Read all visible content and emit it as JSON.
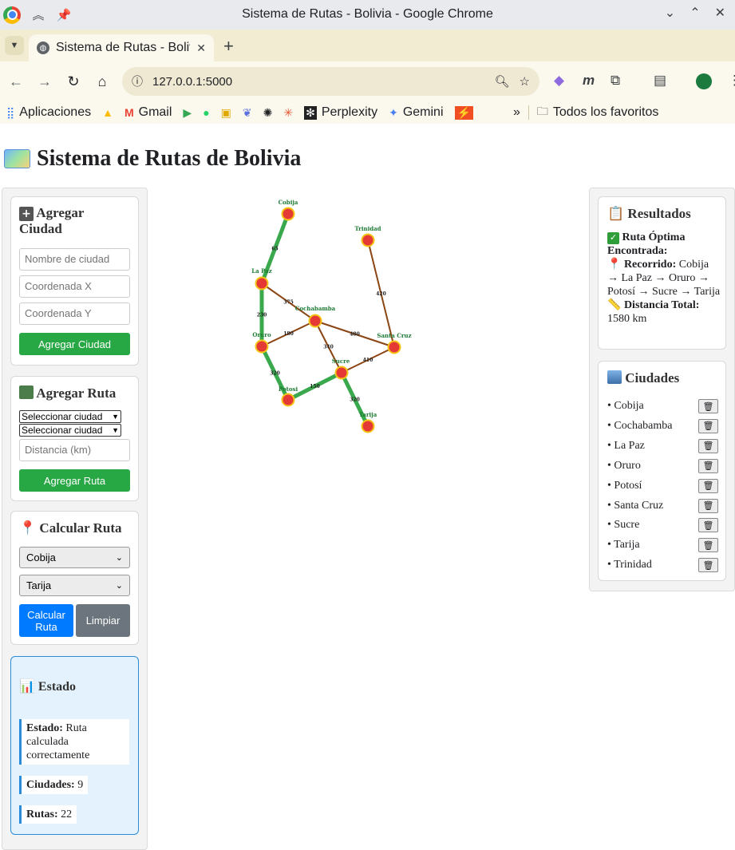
{
  "browser": {
    "window_title": "Sistema de Rutas - Bolivia - Google Chrome",
    "tab_title": "Sistema de Rutas - Bolivia",
    "url": "127.0.0.1:5000",
    "bookmarks": [
      "Aplicaciones",
      "Gmail",
      "Perplexity",
      "Gemini"
    ],
    "all_bookmarks": "Todos los favoritos"
  },
  "page": {
    "title": "Sistema de Rutas de Bolivia"
  },
  "add_city": {
    "title": "Agregar Ciudad",
    "name_placeholder": "Nombre de ciudad",
    "x_placeholder": "Coordenada X",
    "y_placeholder": "Coordenada Y",
    "button": "Agregar Ciudad"
  },
  "add_route": {
    "title": "Agregar Ruta",
    "select_from": "Seleccionar ciudad",
    "select_to": "Seleccionar ciudad",
    "distance_placeholder": "Distancia (km)",
    "button": "Agregar Ruta"
  },
  "calc_route": {
    "title": "Calcular Ruta",
    "origin": "Cobija",
    "destination": "Tarija",
    "calc_button": "Calcular Ruta",
    "clear_button": "Limpiar"
  },
  "status": {
    "title": "Estado",
    "estado_label": "Estado:",
    "estado_value": "Ruta calculada correctamente",
    "cities_label": "Ciudades:",
    "cities_value": "9",
    "routes_label": "Rutas:",
    "routes_value": "22"
  },
  "results": {
    "title": "Resultados",
    "found_label": "Ruta Óptima Encontrada:",
    "path_label": "Recorrido:",
    "path_value": "Cobija → La Paz → Oruro → Potosí → Sucre → Tarija",
    "distance_label": "Distancia Total:",
    "distance_value": "1580 km"
  },
  "cities_panel": {
    "title": "Ciudades",
    "items": [
      "• Cobija",
      "• Cochabamba",
      "• La Paz",
      "• Oruro",
      "• Potosí",
      "• Santa Cruz",
      "• Sucre",
      "• Tarija",
      "• Trinidad"
    ]
  },
  "graph": {
    "nodes": [
      "Cobija",
      "Trinidad",
      "La Paz",
      "Cochabamba",
      "Oruro",
      "Santa Cruz",
      "Sucre",
      "Potosi",
      "Tarija"
    ],
    "edges": [
      {
        "from": "Cobija",
        "to": "La Paz",
        "label": "65",
        "highlight": true
      },
      {
        "from": "La Paz",
        "to": "Oruro",
        "label": "230",
        "highlight": true
      },
      {
        "from": "Oruro",
        "to": "Potosi",
        "label": "320",
        "highlight": true
      },
      {
        "from": "Potosi",
        "to": "Sucre",
        "label": "150",
        "highlight": true
      },
      {
        "from": "Sucre",
        "to": "Tarija",
        "label": "320",
        "highlight": true
      },
      {
        "from": "La Paz",
        "to": "Cochabamba",
        "label": "375",
        "highlight": false
      },
      {
        "from": "Oruro",
        "to": "Cochabamba",
        "label": "180",
        "highlight": false
      },
      {
        "from": "Cochabamba",
        "to": "Santa Cruz",
        "label": "480",
        "highlight": false
      },
      {
        "from": "Cochabamba",
        "to": "Sucre",
        "label": "340",
        "highlight": false
      },
      {
        "from": "Trinidad",
        "to": "Santa Cruz",
        "label": "420",
        "highlight": false
      },
      {
        "from": "Sucre",
        "to": "Santa Cruz",
        "label": "410",
        "highlight": false
      }
    ],
    "colors": {
      "highlight": "#3aa84c",
      "edge": "#8b4513",
      "node": "#e53935",
      "node_border": "#f5c518",
      "label": "#1e7b34"
    }
  }
}
